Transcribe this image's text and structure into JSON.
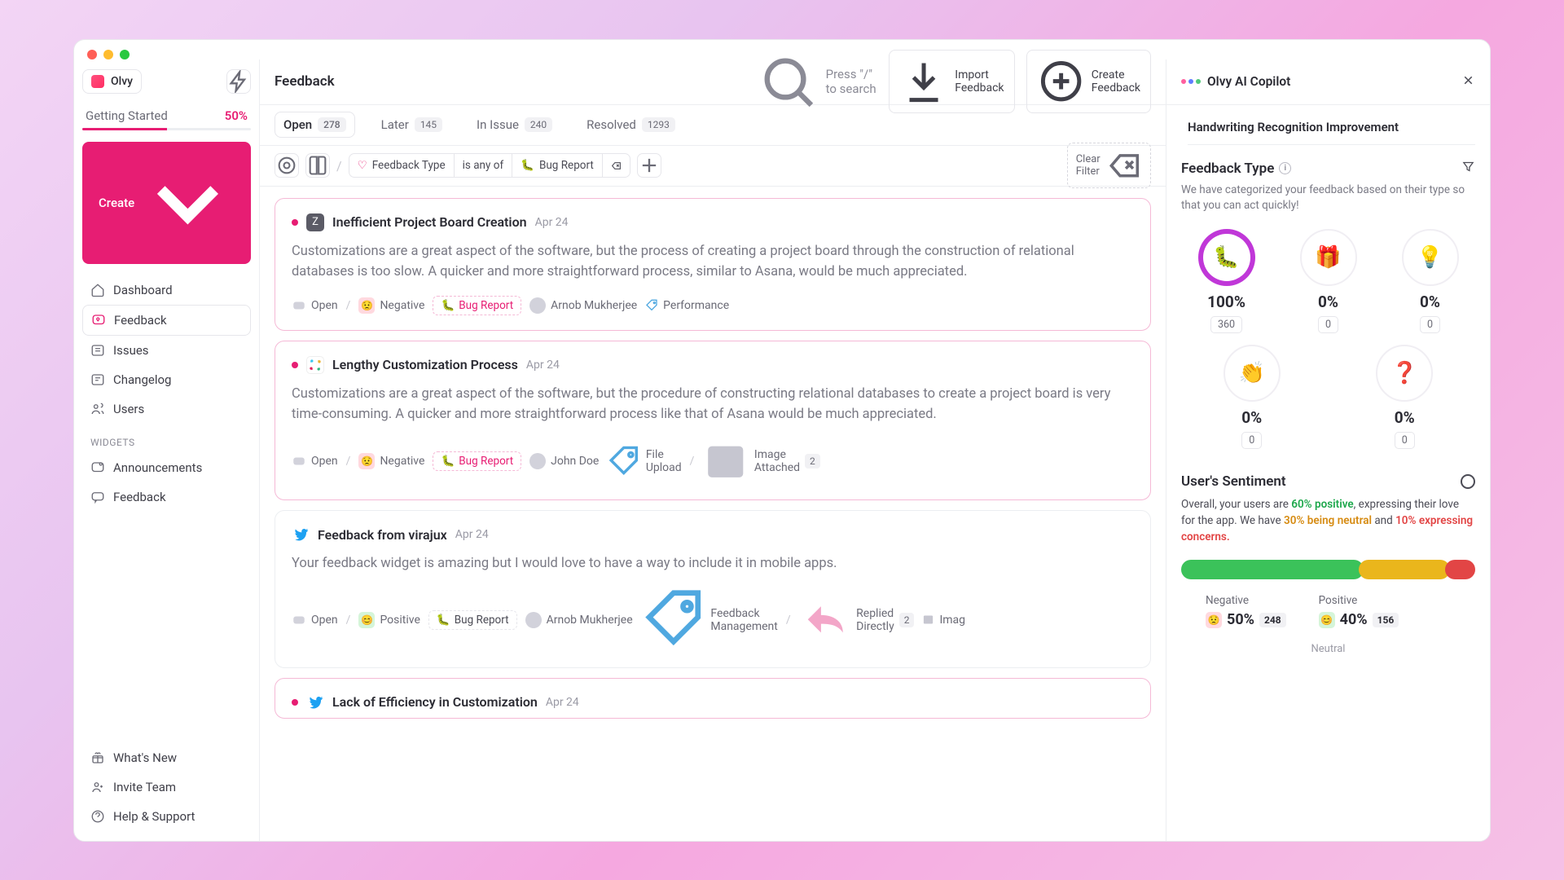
{
  "brand": "Olvy",
  "gettingStarted": {
    "label": "Getting Started",
    "pct": "50%"
  },
  "createLabel": "Create",
  "nav": {
    "dashboard": "Dashboard",
    "feedback": "Feedback",
    "issues": "Issues",
    "changelog": "Changelog",
    "users": "Users"
  },
  "widgetsLabel": "WIDGETS",
  "widgets": {
    "announcements": "Announcements",
    "feedback": "Feedback"
  },
  "footer": {
    "whatsnew": "What's New",
    "invite": "Invite Team",
    "help": "Help & Support"
  },
  "pageTitle": "Feedback",
  "searchPlaceholder": "Press \"/\" to search",
  "importBtn": "Import Feedback",
  "createBtn": "Create Feedback",
  "tabs": {
    "open": {
      "label": "Open",
      "count": "278"
    },
    "later": {
      "label": "Later",
      "count": "145"
    },
    "inissue": {
      "label": "In Issue",
      "count": "240"
    },
    "resolved": {
      "label": "Resolved",
      "count": "1293"
    }
  },
  "filter": {
    "typeLabel": "Feedback Type",
    "condition": "is any of",
    "value": "Bug Report",
    "clear": "Clear Filter"
  },
  "cards": [
    {
      "title": "Inefficient Project Board Creation",
      "date": "Apr 24",
      "body": "Customizations are a great aspect of the software, but the process of creating a project board through the construction of relational databases is too slow. A quicker and more straightforward process, similar to Asana, would be much appreciated.",
      "status": "Open",
      "sentiment": "Negative",
      "tag": "Bug Report",
      "author": "Arnob Mukherjee",
      "label": "Performance"
    },
    {
      "title": "Lengthy Customization Process",
      "date": "Apr 24",
      "body": "Customizations are a great aspect of the software, but the procedure of constructing relational databases to create a project board is very time-consuming. A quicker and more straightforward process like that of Asana would be much appreciated.",
      "status": "Open",
      "sentiment": "Negative",
      "tag": "Bug Report",
      "author": "John Doe",
      "label": "File Upload",
      "extra": "Image Attached",
      "extraCount": "2"
    },
    {
      "title": "Feedback from virajux",
      "date": "Apr 24",
      "body": "Your feedback widget is amazing but I would love to have a way to include it in mobile apps.",
      "status": "Open",
      "sentiment": "Positive",
      "tag": "Bug Report",
      "author": "Arnob Mukherjee",
      "label": "Feedback Management",
      "extra": "Replied Directly",
      "extraCount": "2",
      "extra2": "Imag"
    },
    {
      "title": "Lack of Efficiency in Customization",
      "date": "Apr 24"
    }
  ],
  "copilot": {
    "title": "Olvy AI Copilot",
    "peek": "Handwriting Recognition Improvement",
    "feedbackType": {
      "title": "Feedback Type",
      "desc": "We have categorized your feedback based on their type so that you can act quickly!",
      "cells": [
        {
          "emoji": "🐛",
          "pct": "100%",
          "count": "360",
          "full": true
        },
        {
          "emoji": "🎁",
          "pct": "0%",
          "count": "0"
        },
        {
          "emoji": "💡",
          "pct": "0%",
          "count": "0"
        },
        {
          "emoji": "👏",
          "pct": "0%",
          "count": "0"
        },
        {
          "emoji": "❓",
          "pct": "0%",
          "count": "0"
        }
      ]
    },
    "sentiment": {
      "title": "User's Sentiment",
      "prefix": "Overall, your users are ",
      "pos": "60% positive",
      "mid1": ", expressing their love for the app. We have ",
      "neu": "30% being neutral",
      "mid2": " and ",
      "neg": "10% expressing concerns.",
      "negLabel": "Negative",
      "negPct": "50%",
      "negCount": "248",
      "posLabel": "Positive",
      "posPct": "40%",
      "posCount": "156",
      "neutralLabel": "Neutral"
    }
  }
}
